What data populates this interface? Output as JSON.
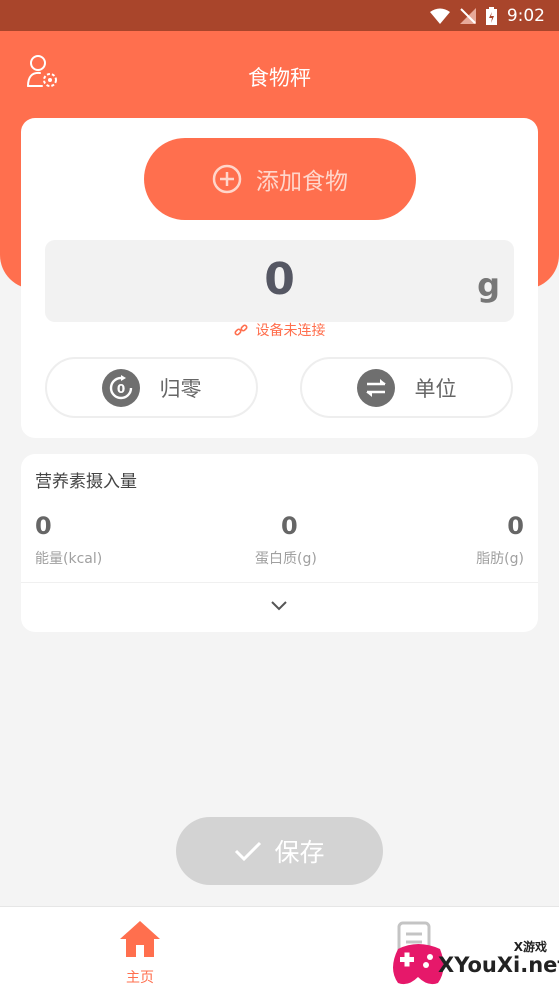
{
  "status_bar": {
    "time": "9:02"
  },
  "header": {
    "title": "食物秤"
  },
  "scale": {
    "add_food_label": "添加食物",
    "weight_value": "0",
    "weight_unit": "g",
    "device_status": "设备未连接",
    "zero_label": "归零",
    "unit_label": "单位"
  },
  "nutrition": {
    "title": "营养素摄入量",
    "items": [
      {
        "value": "0",
        "label": "能量(kcal)"
      },
      {
        "value": "0",
        "label": "蛋白质(g)"
      },
      {
        "value": "0",
        "label": "脂肪(g)"
      }
    ]
  },
  "save_label": "保存",
  "bottom_nav": {
    "home_label": "主页"
  },
  "watermark": {
    "small": "X游戏",
    "text": "XYouXi.net"
  },
  "colors": {
    "accent": "#ff6f4e",
    "status_bar": "#a9452b"
  }
}
